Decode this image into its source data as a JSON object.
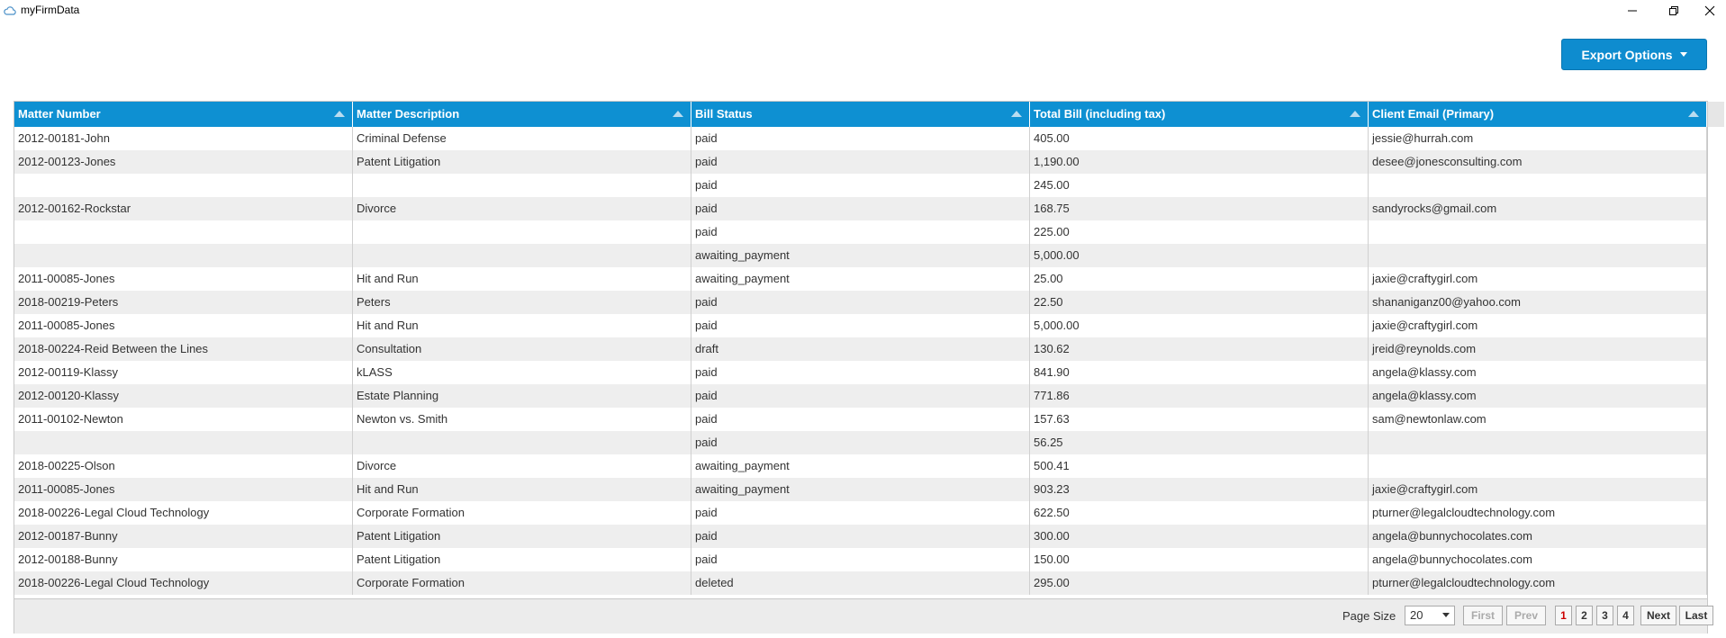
{
  "window": {
    "title": "myFirmData",
    "icon": "cloud-icon",
    "minimize_glyph": "—",
    "maximize_glyph": "❐",
    "close_glyph": "✕"
  },
  "toolbar": {
    "export_label": "Export Options"
  },
  "table": {
    "columns": [
      "Matter Number",
      "Matter Description",
      "Bill Status",
      "Total Bill (including tax)",
      "Client Email (Primary)"
    ],
    "rows": [
      [
        "2012-00181-John",
        "Criminal Defense",
        "paid",
        "405.00",
        "jessie@hurrah.com"
      ],
      [
        "2012-00123-Jones",
        "Patent Litigation",
        "paid",
        "1,190.00",
        "desee@jonesconsulting.com"
      ],
      [
        "",
        "",
        "paid",
        "245.00",
        ""
      ],
      [
        "2012-00162-Rockstar",
        "Divorce",
        "paid",
        "168.75",
        "sandyrocks@gmail.com"
      ],
      [
        "",
        "",
        "paid",
        "225.00",
        ""
      ],
      [
        "",
        "",
        "awaiting_payment",
        "5,000.00",
        ""
      ],
      [
        "2011-00085-Jones",
        "Hit and Run",
        "awaiting_payment",
        "25.00",
        "jaxie@craftygirl.com"
      ],
      [
        "2018-00219-Peters",
        "Peters",
        "paid",
        "22.50",
        "shananiganz00@yahoo.com"
      ],
      [
        "2011-00085-Jones",
        "Hit and Run",
        "paid",
        "5,000.00",
        "jaxie@craftygirl.com"
      ],
      [
        "2018-00224-Reid Between the Lines",
        "Consultation",
        "draft",
        "130.62",
        "jreid@reynolds.com"
      ],
      [
        "2012-00119-Klassy",
        "kLASS",
        "paid",
        "841.90",
        "angela@klassy.com"
      ],
      [
        "2012-00120-Klassy",
        "Estate Planning",
        "paid",
        "771.86",
        "angela@klassy.com"
      ],
      [
        "2011-00102-Newton",
        "Newton vs. Smith",
        "paid",
        "157.63",
        "sam@newtonlaw.com"
      ],
      [
        "",
        "",
        "paid",
        "56.25",
        ""
      ],
      [
        "2018-00225-Olson",
        "Divorce",
        "awaiting_payment",
        "500.41",
        ""
      ],
      [
        "2011-00085-Jones",
        "Hit and Run",
        "awaiting_payment",
        "903.23",
        "jaxie@craftygirl.com"
      ],
      [
        "2018-00226-Legal Cloud Technology",
        "Corporate Formation",
        "paid",
        "622.50",
        "pturner@legalcloudtechnology.com"
      ],
      [
        "2012-00187-Bunny",
        "Patent Litigation",
        "paid",
        "300.00",
        "angela@bunnychocolates.com"
      ],
      [
        "2012-00188-Bunny",
        "Patent Litigation",
        "paid",
        "150.00",
        "angela@bunnychocolates.com"
      ],
      [
        "2018-00226-Legal Cloud Technology",
        "Corporate Formation",
        "deleted",
        "295.00",
        "pturner@legalcloudtechnology.com"
      ]
    ]
  },
  "pagination": {
    "page_size_label": "Page Size",
    "page_size_value": "20",
    "first_label": "First",
    "prev_label": "Prev",
    "pages": [
      "1",
      "2",
      "3",
      "4"
    ],
    "current_page": "1",
    "next_label": "Next",
    "last_label": "Last"
  },
  "colors": {
    "header_bg": "#0e90d2",
    "button_bg": "#0e8ccf",
    "alt_row": "#eeeeee",
    "current_page": "#cc0000"
  }
}
